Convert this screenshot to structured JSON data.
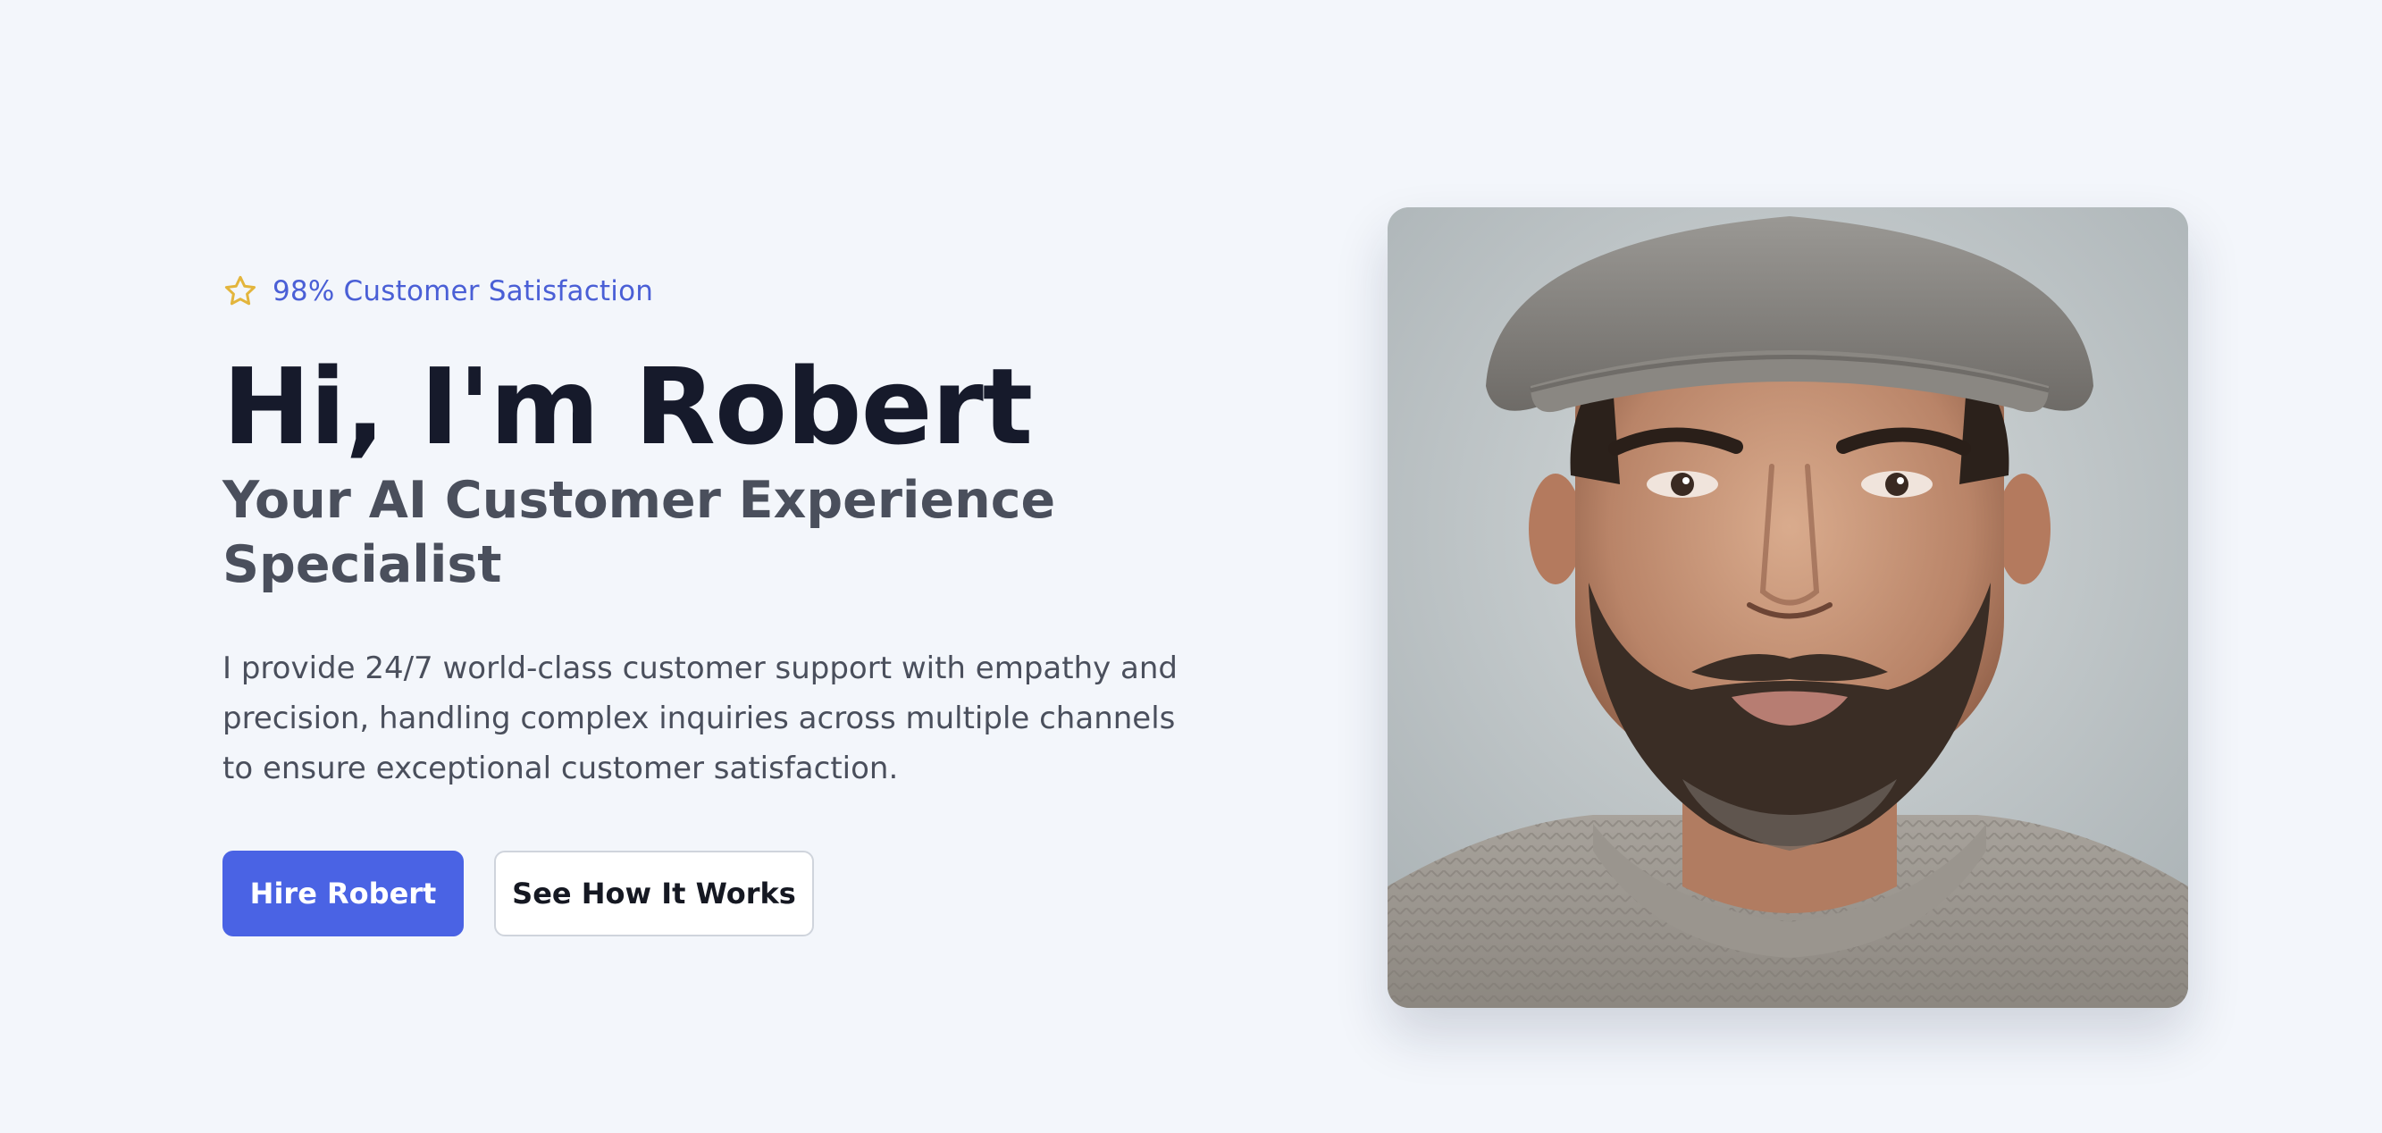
{
  "hero": {
    "badge": {
      "icon": "star-icon",
      "text": "98% Customer Satisfaction",
      "color": "#4a5fd6",
      "icon_color": "#e3b53c"
    },
    "title": "Hi, I'm Robert",
    "subtitle": "Your AI Customer Experience Specialist",
    "description": "I provide 24/7 world-class customer support with empathy and precision, handling complex inquiries across multiple channels to ensure exceptional customer satisfaction.",
    "primary_button": "Hire Robert",
    "secondary_button": "See How It Works",
    "accent_color": "#4a63e4"
  }
}
